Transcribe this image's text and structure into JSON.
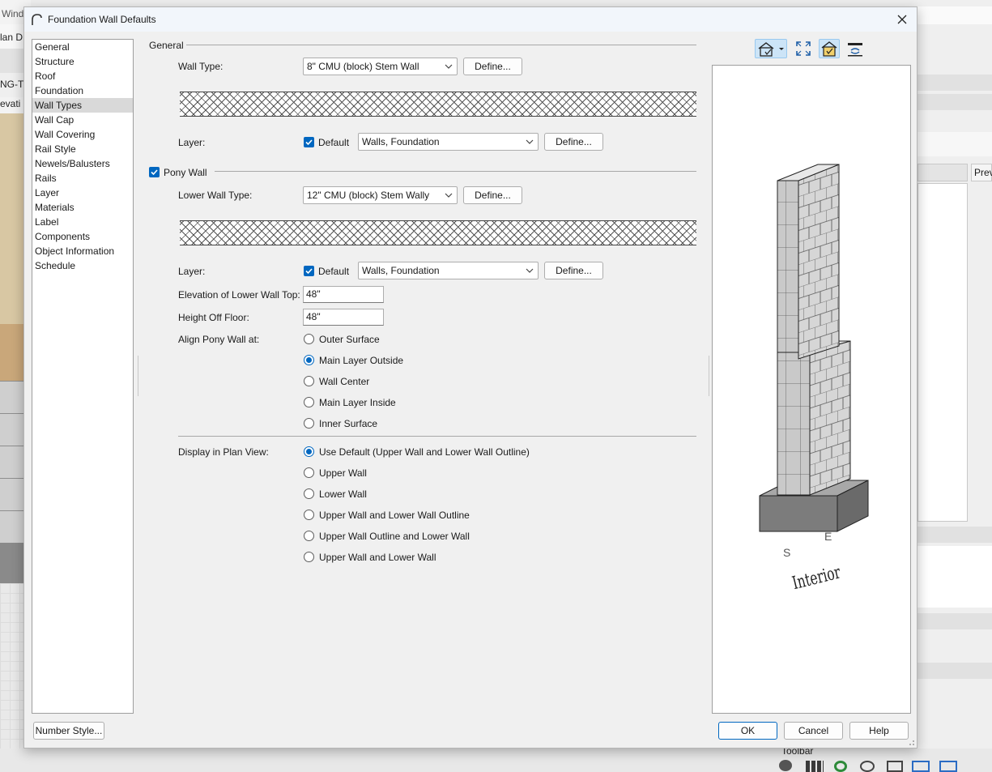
{
  "background": {
    "title_fragment": "Wind",
    "left_fragments": [
      "lan D",
      "NG-TE",
      "evati"
    ],
    "right_fragment": "Prev",
    "bottom_panel_title": "Toolbar"
  },
  "dialog": {
    "title": "Foundation Wall Defaults",
    "nav_items": [
      "General",
      "Structure",
      "Roof",
      "Foundation",
      "Wall Types",
      "Wall Cap",
      "Wall Covering",
      "Rail Style",
      "Newels/Balusters",
      "Rails",
      "Layer",
      "Materials",
      "Label",
      "Components",
      "Object Information",
      "Schedule"
    ],
    "selected_nav": "Wall Types",
    "general": {
      "section_label": "General",
      "wall_type_label": "Wall Type:",
      "wall_type_value": "8\" CMU (block) Stem Wall",
      "define_label": "Define...",
      "layer_label": "Layer:",
      "default_label": "Default",
      "layer_value": "Walls,  Foundation"
    },
    "pony": {
      "section_label": "Pony Wall",
      "checked": true,
      "lower_wall_type_label": "Lower Wall Type:",
      "lower_wall_type_value": "12\" CMU (block) Stem Wally",
      "layer_label": "Layer:",
      "default_label": "Default",
      "layer_value": "Walls,  Foundation",
      "elev_label": "Elevation of Lower Wall Top:",
      "elev_value": "48\"",
      "height_label": "Height Off Floor:",
      "height_value": "48\"",
      "align_label": "Align Pony Wall at:",
      "align_options": [
        "Outer Surface",
        "Main Layer Outside",
        "Wall Center",
        "Main Layer Inside",
        "Inner Surface"
      ],
      "align_selected": 1
    },
    "display": {
      "label": "Display in Plan View:",
      "options": [
        "Use Default (Upper Wall and Lower Wall Outline)",
        "Upper Wall",
        "Lower Wall",
        "Upper Wall and Lower Wall Outline",
        "Upper Wall Outline and Lower Wall",
        "Upper Wall and Lower Wall"
      ],
      "selected": 0
    },
    "preview": {
      "label_s": "S",
      "label_e": "E",
      "label_interior": "Interior"
    },
    "buttons": {
      "number_style": "Number Style...",
      "ok": "OK",
      "cancel": "Cancel",
      "help": "Help"
    },
    "colors": {
      "accent": "#0067c0",
      "selection": "#d9d9d9",
      "toolbar_active": "#cce4f7"
    }
  }
}
